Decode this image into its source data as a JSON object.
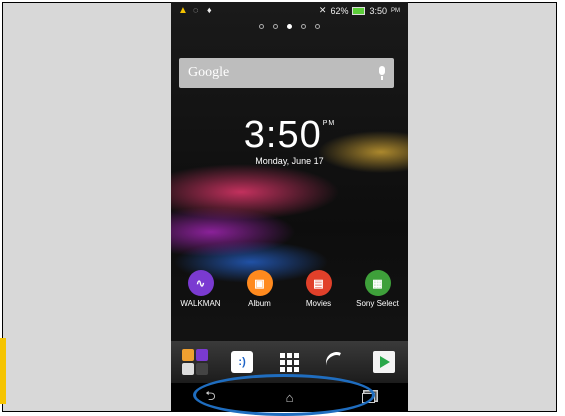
{
  "status_bar": {
    "battery_percent": "62%",
    "time": "3:50",
    "time_suffix": "PM"
  },
  "home_pages": {
    "count": 5,
    "active_index": 2
  },
  "search": {
    "brand": "Google"
  },
  "clock": {
    "time": "3:50",
    "ampm": "PM",
    "date": "Monday, June 17"
  },
  "apps": [
    {
      "label": "WALKMAN",
      "icon": "walkman-icon",
      "color": "#7a3ad1"
    },
    {
      "label": "Album",
      "icon": "album-icon",
      "color": "#ff8a1e"
    },
    {
      "label": "Movies",
      "icon": "movies-icon",
      "color": "#e1402a"
    },
    {
      "label": "Sony Select",
      "icon": "sony-select-icon",
      "color": "#3ea03a"
    }
  ],
  "dock": [
    {
      "icon": "folder-icon"
    },
    {
      "icon": "messaging-icon"
    },
    {
      "icon": "app-drawer-icon"
    },
    {
      "icon": "phone-icon"
    },
    {
      "icon": "play-store-icon"
    }
  ],
  "navigation": {
    "buttons": [
      "back-icon",
      "home-icon",
      "recent-apps-icon"
    ],
    "highlight_color": "#1f6dbf"
  }
}
